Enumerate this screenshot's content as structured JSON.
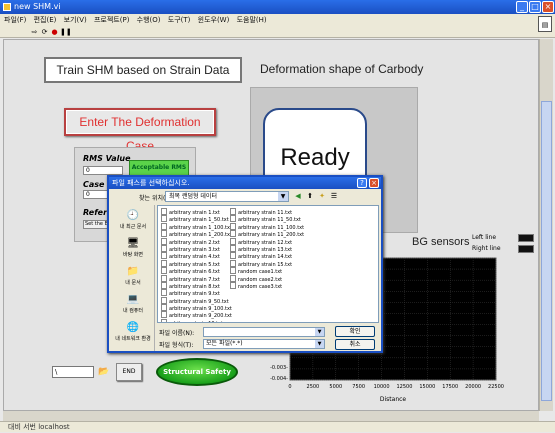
{
  "window": {
    "title": "new SHM.vi",
    "minimize_label": "_",
    "maximize_label": "□",
    "close_label": "×"
  },
  "menu": [
    "파일(F)",
    "편집(E)",
    "보기(V)",
    "프로젝트(P)",
    "수행(O)",
    "도구(T)",
    "윈도우(W)",
    "도움말(H)"
  ],
  "toolbar": {
    "run": "⇨",
    "run_continuous": "⟳",
    "abort": "●",
    "pause": "❚❚"
  },
  "panel": {
    "title": "Train SHM based on Strain Data",
    "deformation_label": "Deformation shape of Carbody",
    "enter_button": "Enter The Deformation Case",
    "rms_label": "RMS Value",
    "rms_value": "0",
    "acceptable": "Acceptable RMS",
    "case_label": "Case",
    "case_value": "0",
    "reference_label": "Referen",
    "reference_button": "Set the Bu",
    "ready_text": "Ready",
    "fbg_label": "BG sensors",
    "legend": [
      "Left line",
      "Right line"
    ],
    "path_value": "\\",
    "end_button": "END",
    "safety_button": "Structural Safety"
  },
  "chart_data": {
    "type": "line",
    "xlabel": "Distance",
    "x_ticks": [
      "0",
      "2500",
      "5000",
      "7500",
      "10000",
      "12500",
      "15000",
      "17500",
      "20000",
      "22500"
    ],
    "y_ticks": [
      "-0.003-",
      "-0.004-"
    ],
    "grid": true,
    "legend_placement": "top-right",
    "series": [
      {
        "name": "Left line",
        "color": "#111111",
        "values": []
      },
      {
        "name": "Right line",
        "color": "#111111",
        "values": []
      }
    ]
  },
  "dialog": {
    "title": "파일 패스를 선택하십시오.",
    "help_label": "?",
    "close_label": "×",
    "look_in_label": "찾는 위치(I):",
    "look_in_value": "최목 랜덤형 데이터",
    "places": [
      "내 최근 문서",
      "바탕 화면",
      "내 문서",
      "내 컴퓨터",
      "내 네트워크 환경"
    ],
    "files_col1": [
      "arbitrary strain 1.txt",
      "arbitrary strain 1_50.txt",
      "arbitrary strain 1_100.txt",
      "arbitrary strain 1_200.txt",
      "arbitrary strain 2.txt",
      "arbitrary strain 3.txt",
      "arbitrary strain 4.txt",
      "arbitrary strain 5.txt",
      "arbitrary strain 6.txt",
      "arbitrary strain 7.txt",
      "arbitrary strain 8.txt",
      "arbitrary strain 9.txt",
      "arbitrary strain 9_50.txt",
      "arbitrary strain 9_100.txt",
      "arbitrary strain 9_200.txt",
      "arbitrary strain 10.txt"
    ],
    "files_col2": [
      "arbitrary strain 11.txt",
      "arbitrary strain 11_50.txt",
      "arbitrary strain 11_100.txt",
      "arbitrary strain 11_200.txt",
      "arbitrary strain 12.txt",
      "arbitrary strain 13.txt",
      "arbitrary strain 14.txt",
      "arbitrary strain 15.txt",
      "random case1.txt",
      "random case2.txt",
      "random case3.txt"
    ],
    "filename_label": "파일 이름(N):",
    "filename_value": "",
    "filetype_label": "파일 형식(T):",
    "filetype_value": "모든 파일(*.*)",
    "ok_button": "확인",
    "cancel_button": "취소"
  },
  "status": {
    "text": "대비 서번 localhost"
  }
}
